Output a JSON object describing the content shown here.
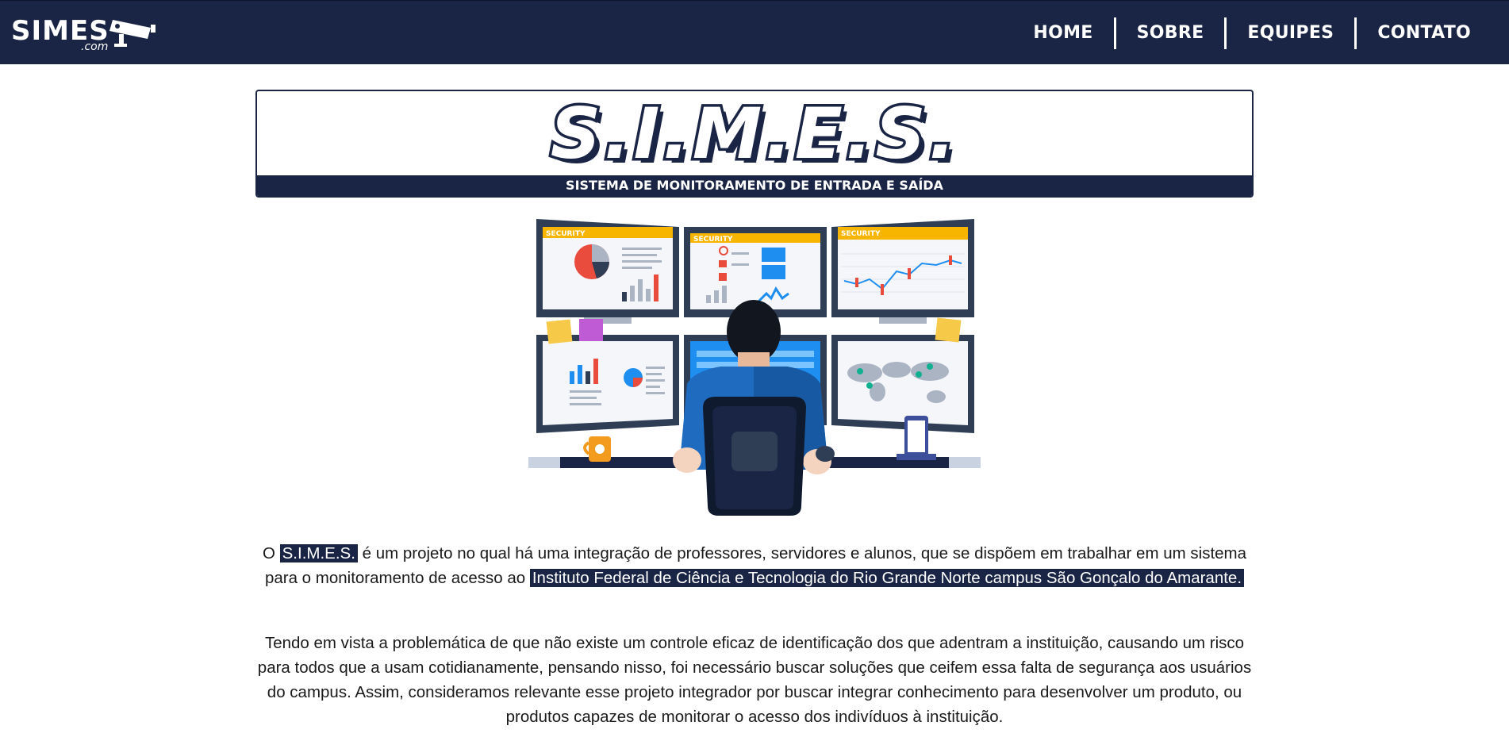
{
  "nav": {
    "logo_text": "SIMES",
    "logo_sub": ".com",
    "items": [
      "HOME",
      "SOBRE",
      "EQUIPES",
      "CONTATO"
    ]
  },
  "banner": {
    "title": "S.I.M.E.S.",
    "subtitle": "SISTEMA DE MONITORAMENTO DE ENTRADA E SAÍDA"
  },
  "illustration": {
    "screen_label": "SECURITY"
  },
  "content": {
    "p1": {
      "pre": "O ",
      "highlight1": "S.I.M.E.S.",
      "mid": " é um projeto no qual há uma integração de professores, servidores e alunos, que se dispõem em trabalhar em um sistema para o monitoramento de acesso ao ",
      "highlight2": "Instituto Federal de Ciência e Tecnologia do Rio Grande Norte campus São Gonçalo do Amarante."
    },
    "p2": "Tendo em vista a problemática de que não existe um controle eficaz de identificação dos que adentram a instituição, causando um risco para todos que a usam cotidianamente, pensando nisso, foi necessário buscar soluções que ceifem essa falta de segurança aos usuários do campus. Assim, consideramos relevante esse projeto integrador por buscar integrar conhecimento para desenvolver um produto, ou produtos capazes de monitorar o acesso dos indivíduos à instituição."
  },
  "colors": {
    "navy": "#1a2545",
    "accent_yellow": "#f7b500",
    "accent_red": "#e94b3c",
    "accent_blue": "#1f8ef1"
  }
}
